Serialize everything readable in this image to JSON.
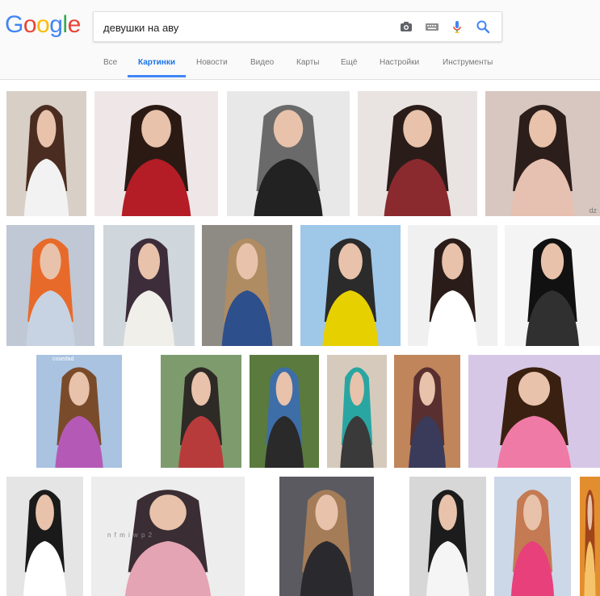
{
  "logo": {
    "letters": [
      "G",
      "o",
      "o",
      "g",
      "l",
      "e"
    ],
    "colors": [
      "#4285F4",
      "#EA4335",
      "#FBBC05",
      "#4285F4",
      "#34A853",
      "#EA4335"
    ]
  },
  "search": {
    "query": "девушки на аву",
    "icons": [
      "camera-icon",
      "keyboard-icon",
      "microphone-icon",
      "search-icon"
    ]
  },
  "tabs": [
    {
      "label": "Все",
      "active": false
    },
    {
      "label": "Картинки",
      "active": true
    },
    {
      "label": "Новости",
      "active": false
    },
    {
      "label": "Видео",
      "active": false
    },
    {
      "label": "Карты",
      "active": false
    },
    {
      "label": "Ещё",
      "active": false
    },
    {
      "label": "Настройки",
      "active": false
    },
    {
      "label": "Инструменты",
      "active": false
    }
  ],
  "results": {
    "watermarks": {
      "r3c1": "cosedad",
      "r4c2": "n f m i w p 2",
      "r1c5": "dz"
    },
    "rows": [
      [
        {
          "bg": "#d8cfc6",
          "fg": "#4a2d20",
          "accent": "#f2f2f2"
        },
        {
          "bg": "#efe7e7",
          "fg": "#2b1a14",
          "accent": "#b51d26"
        },
        {
          "bg": "#e8e8e8",
          "fg": "#6a6a6a",
          "accent": "#222222"
        },
        {
          "bg": "#e9e4e2",
          "fg": "#2a1c19",
          "accent": "#8a2a2f"
        },
        {
          "bg": "#d7c7c0",
          "fg": "#2c1e1a",
          "accent": "#e6c0b0"
        }
      ],
      [
        {
          "bg": "#bfc8d4",
          "fg": "#e86a2a",
          "accent": "#c7d3e2"
        },
        {
          "bg": "#cfd7dc",
          "fg": "#3d2d3a",
          "accent": "#f0efe9"
        },
        {
          "bg": "#8e8a84",
          "fg": "#b08c63",
          "accent": "#2d4f8c"
        },
        {
          "bg": "#9fc7e8",
          "fg": "#2b2b2b",
          "accent": "#e7d000"
        },
        {
          "bg": "#f0f0f0",
          "fg": "#2a1c19",
          "accent": "#ffffff"
        },
        {
          "bg": "#f4f4f4",
          "fg": "#111111",
          "accent": "#303030"
        }
      ],
      [
        {
          "bg": "#a9c3e0",
          "fg": "#7a4b2a",
          "accent": "#b45ab6"
        },
        {
          "bg": "#7e9b6e",
          "fg": "#2e2a26",
          "accent": "#b83b3b"
        },
        {
          "bg": "#5a7a3e",
          "fg": "#3d6ea8",
          "accent": "#2a2a2a"
        },
        {
          "bg": "#d6cabd",
          "fg": "#2aa6a2",
          "accent": "#3a3a3a"
        },
        {
          "bg": "#c0855b",
          "fg": "#5a2f2f",
          "accent": "#3a3b5a"
        },
        {
          "bg": "#d7c7e6",
          "fg": "#3a2010",
          "accent": "#f07aa6"
        }
      ],
      [
        {
          "bg": "#e5e5e5",
          "fg": "#1a1a1a",
          "accent": "#ffffff"
        },
        {
          "bg": "#ededed",
          "fg": "#3a2d33",
          "accent": "#e4a4b4"
        },
        {
          "bg": "#5a5a60",
          "fg": "#a57c58",
          "accent": "#2a2a2e"
        },
        {
          "bg": "#d7d7d7",
          "fg": "#1c1c1c",
          "accent": "#f5f5f5"
        },
        {
          "bg": "#ccd8e8",
          "fg": "#c47a52",
          "accent": "#e8407a"
        },
        {
          "bg": "#e28e2e",
          "fg": "#a0441a",
          "accent": "#f5c46a"
        }
      ]
    ]
  }
}
